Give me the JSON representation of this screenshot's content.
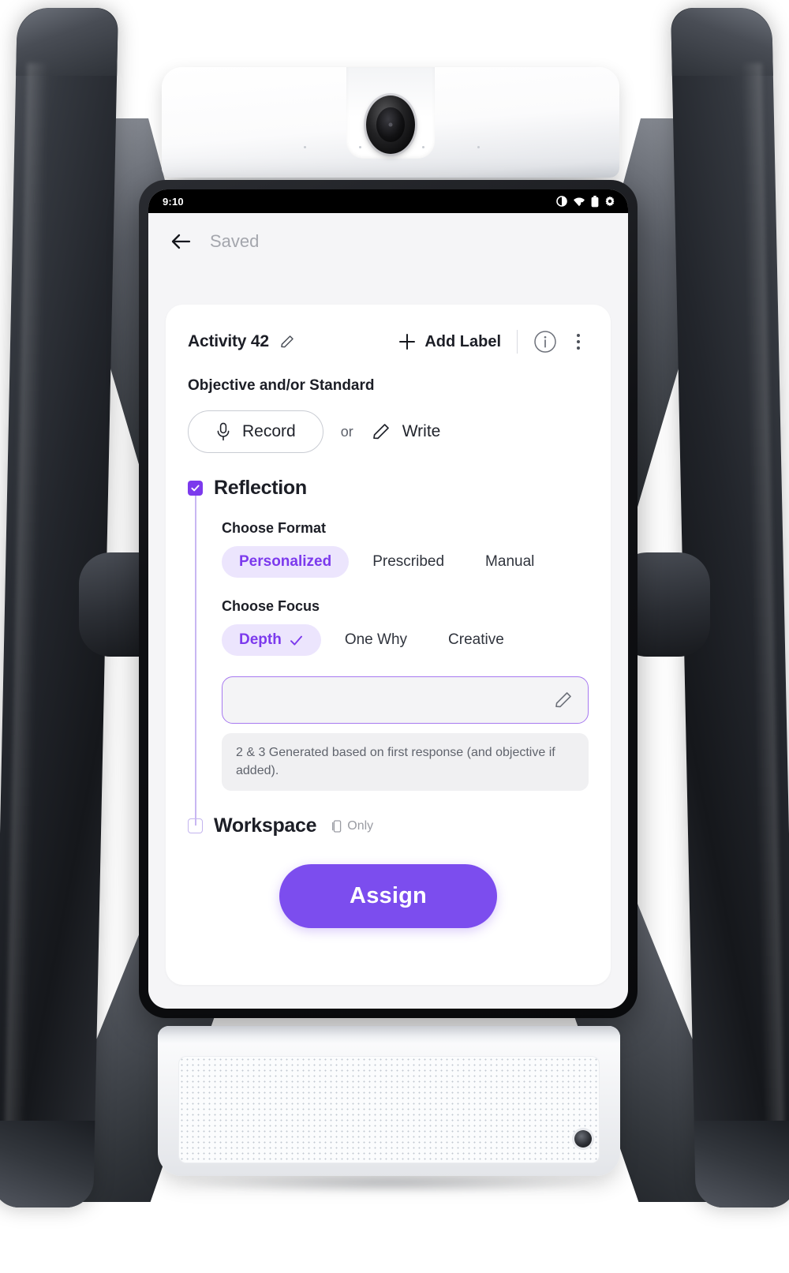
{
  "statusbar": {
    "time": "9:10",
    "icons": [
      "dnd-icon",
      "wifi-icon",
      "battery-icon",
      "gear-icon"
    ]
  },
  "appbar": {
    "back_icon": "back-arrow-icon",
    "title": "Saved"
  },
  "card": {
    "activity_title": "Activity 42",
    "edit_icon": "pencil-icon",
    "add_label": "Add Label",
    "add_icon": "plus-icon",
    "info_icon": "info-circle-icon",
    "menu_icon": "kebab-menu-icon",
    "objective_heading": "Objective and/or Standard",
    "record_label": "Record",
    "record_icon": "microphone-icon",
    "or_text": "or",
    "write_label": "Write",
    "write_icon": "pencil-icon"
  },
  "reflection": {
    "label": "Reflection",
    "checked": true,
    "format": {
      "heading": "Choose Format",
      "options": [
        "Personalized",
        "Prescribed",
        "Manual"
      ],
      "selected": "Personalized"
    },
    "focus": {
      "heading": "Choose Focus",
      "options": [
        "Depth",
        "One Why",
        "Creative"
      ],
      "selected": "Depth",
      "selected_icon": "check-icon"
    },
    "input": {
      "value": "",
      "placeholder": "",
      "edit_icon": "pencil-icon"
    },
    "hint": "2 & 3 Generated based on first response (and objective if added)."
  },
  "workspace": {
    "label": "Workspace",
    "checked": false,
    "badge_icon": "tablet-icon",
    "badge_text": "Only"
  },
  "footer": {
    "assign_label": "Assign"
  },
  "colors": {
    "accent": "#7c4dee",
    "chip_bg": "#ece5fd",
    "chip_text": "#7c3aed",
    "screen_bg": "#f5f5f7",
    "card_bg": "#ffffff",
    "text_primary": "#1c1e26",
    "text_muted": "#9a9ca3"
  }
}
